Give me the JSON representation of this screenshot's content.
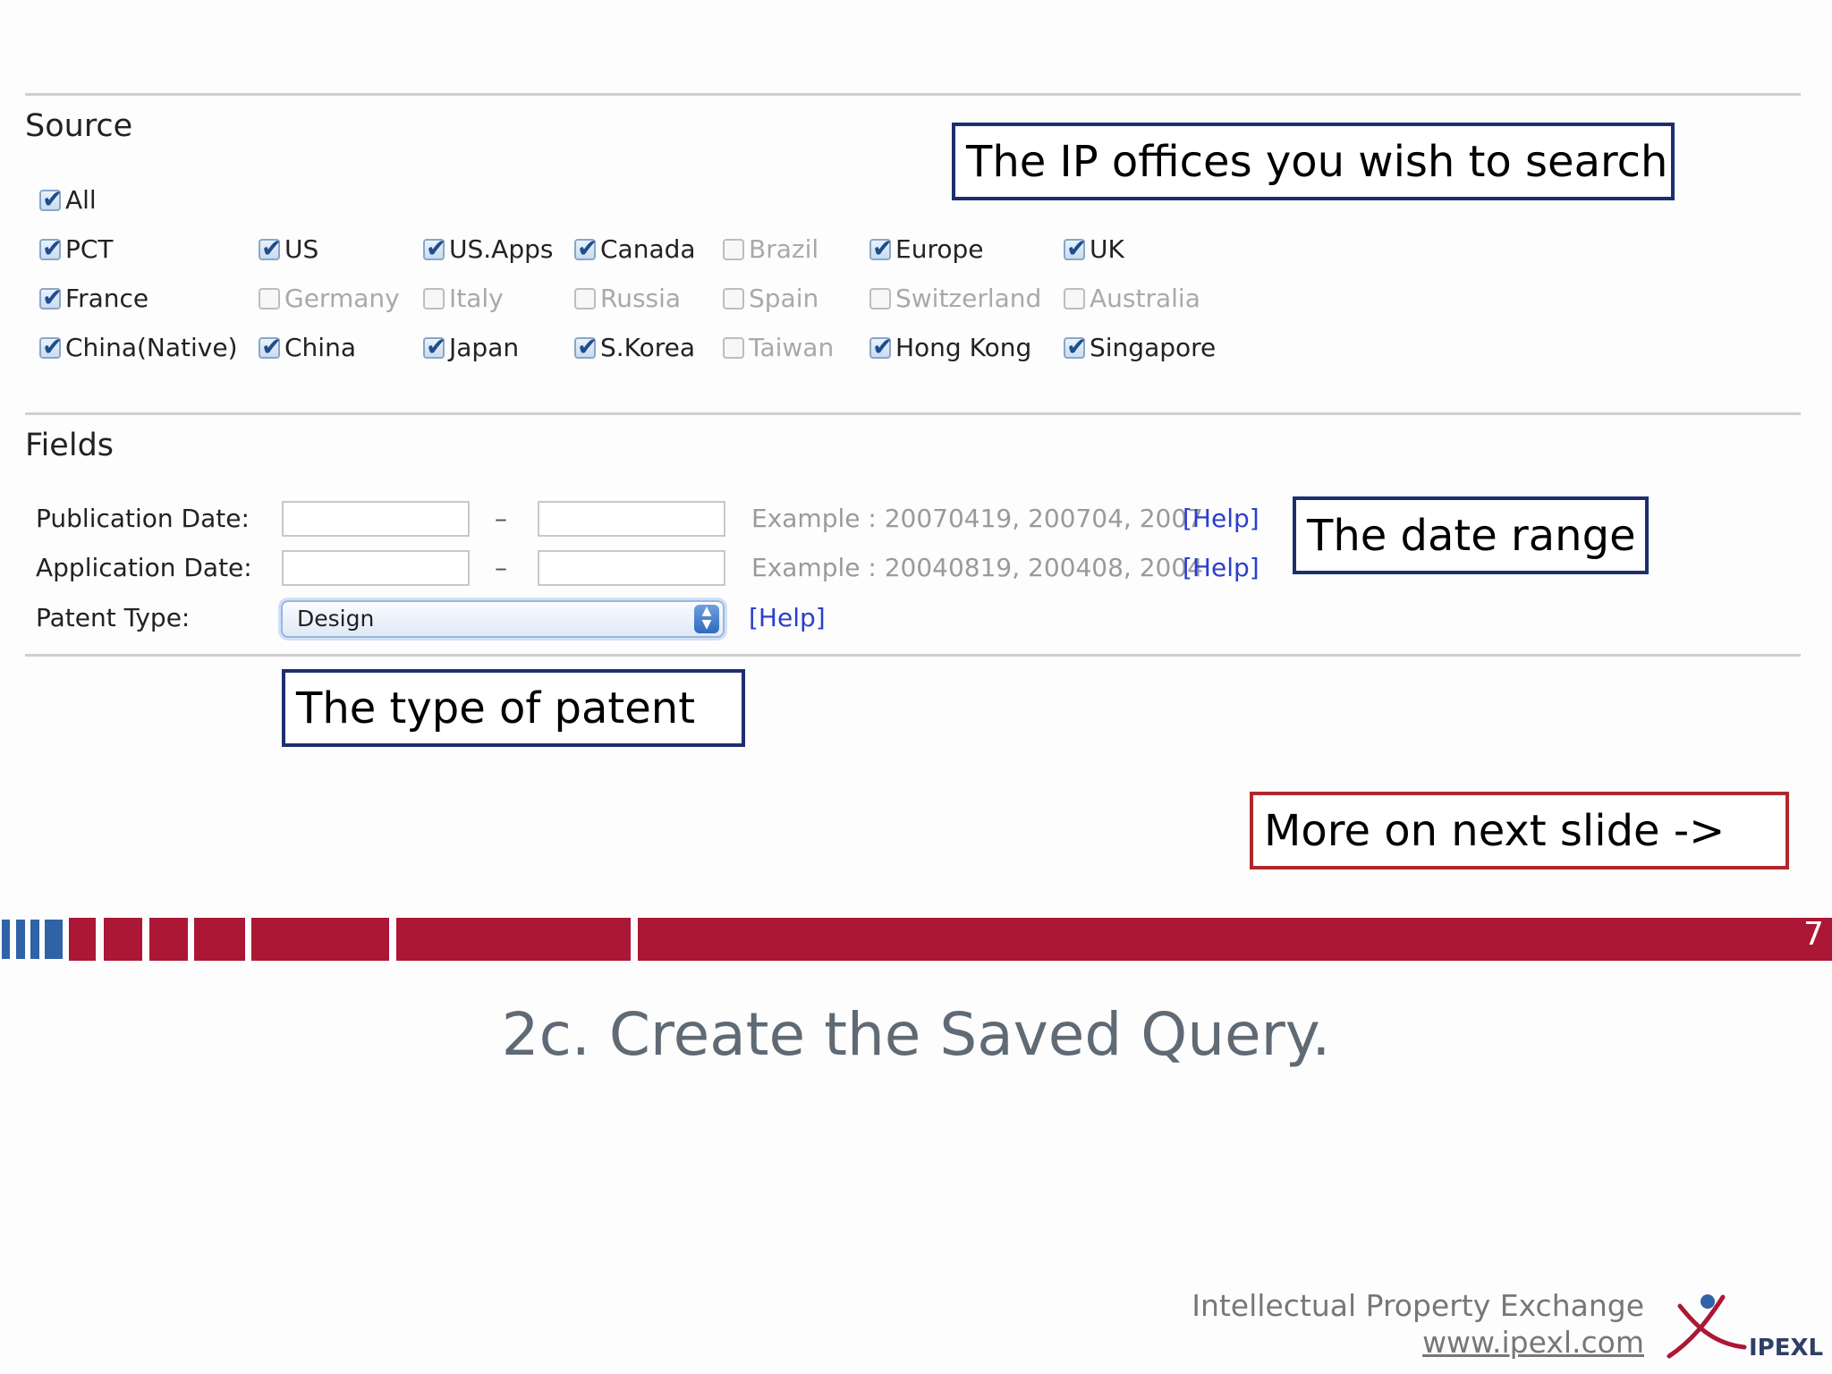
{
  "source": {
    "title": "Source",
    "all": {
      "label": "All",
      "checked": true
    },
    "offices": [
      [
        {
          "label": "PCT",
          "checked": true
        },
        {
          "label": "US",
          "checked": true
        },
        {
          "label": "US.Apps",
          "checked": true
        },
        {
          "label": "Canada",
          "checked": true
        },
        {
          "label": "Brazil",
          "checked": false
        },
        {
          "label": "Europe",
          "checked": true
        },
        {
          "label": "UK",
          "checked": true
        }
      ],
      [
        {
          "label": "France",
          "checked": true
        },
        {
          "label": "Germany",
          "checked": false
        },
        {
          "label": "Italy",
          "checked": false
        },
        {
          "label": "Russia",
          "checked": false
        },
        {
          "label": "Spain",
          "checked": false
        },
        {
          "label": "Switzerland",
          "checked": false
        },
        {
          "label": "Australia",
          "checked": false
        }
      ],
      [
        {
          "label": "China(Native)",
          "checked": true
        },
        {
          "label": "China",
          "checked": true
        },
        {
          "label": "Japan",
          "checked": true
        },
        {
          "label": "S.Korea",
          "checked": true
        },
        {
          "label": "Taiwan",
          "checked": false
        },
        {
          "label": "Hong Kong",
          "checked": true
        },
        {
          "label": "Singapore",
          "checked": true
        }
      ]
    ]
  },
  "fields": {
    "title": "Fields",
    "publication_date": {
      "label": "Publication Date:",
      "dash": "–",
      "from_value": "",
      "to_value": "",
      "example": "Example : 20070419, 200704, 2007",
      "help": "[Help]"
    },
    "application_date": {
      "label": "Application Date:",
      "dash": "–",
      "from_value": "",
      "to_value": "",
      "example": "Example : 20040819, 200408, 2004",
      "help": "[Help]"
    },
    "patent_type": {
      "label": "Patent Type:",
      "selected": "Design",
      "help": "[Help]"
    }
  },
  "callouts": {
    "ip_offices": "The IP offices you wish to search",
    "date_range": "The date range",
    "patent_type": "The type of patent",
    "next_slide": "More on next slide ->"
  },
  "slide": {
    "page_number": "7",
    "title": "2c. Create the Saved Query."
  },
  "footer": {
    "org_name": "Intellectual Property Exchange",
    "website": "www.ipexl.com",
    "logo_text": "IPEXL"
  },
  "colors": {
    "accent_red": "#ac1735",
    "accent_blue": "#2f62a6",
    "callout_navy": "#1d2f6f",
    "callout_red": "#b0282a",
    "help_link": "#2a3ed0"
  }
}
